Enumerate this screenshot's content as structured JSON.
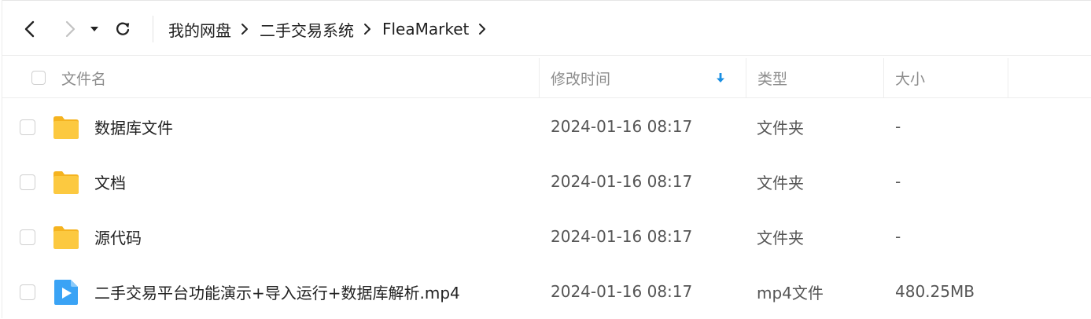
{
  "toolbar": {
    "back_icon": "chevron-left-icon",
    "forward_icon": "chevron-right-icon",
    "dropdown_icon": "caret-down-icon",
    "refresh_icon": "refresh-icon",
    "breadcrumb": [
      "我的网盘",
      "二手交易系统",
      "FleaMarket"
    ]
  },
  "header": {
    "name": "文件名",
    "modified": "修改时间",
    "type": "类型",
    "size": "大小",
    "sort_icon": "arrow-down-icon",
    "sort_color": "#1a8fe3"
  },
  "files": [
    {
      "name": "数据库文件",
      "modified": "2024-01-16 08:17",
      "type": "文件夹",
      "size": "-",
      "icon": "folder-icon"
    },
    {
      "name": "文档",
      "modified": "2024-01-16 08:17",
      "type": "文件夹",
      "size": "-",
      "icon": "folder-icon"
    },
    {
      "name": "源代码",
      "modified": "2024-01-16 08:17",
      "type": "文件夹",
      "size": "-",
      "icon": "folder-icon"
    },
    {
      "name": "二手交易平台功能演示+导入运行+数据库解析.mp4",
      "modified": "2024-01-16 08:17",
      "type": "mp4文件",
      "size": "480.25MB",
      "icon": "video-file-icon"
    }
  ],
  "colors": {
    "folder": "#fcc53b",
    "video": "#3aa3f5"
  }
}
